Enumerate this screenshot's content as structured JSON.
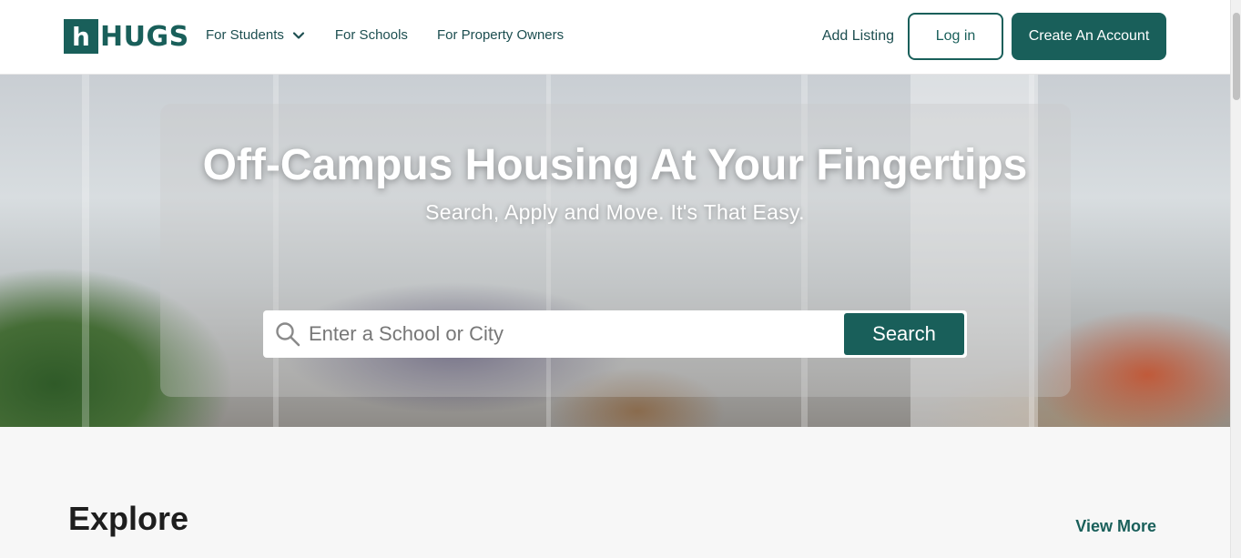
{
  "header": {
    "logo_text": "HUGS",
    "logo_mark": "h",
    "nav": [
      {
        "label": "For Students",
        "icon": "chevron-down-icon"
      },
      {
        "label": "For Schools"
      },
      {
        "label": "For Property Owners"
      }
    ],
    "add_listing": "Add Listing",
    "login": "Log in",
    "create_account": "Create An Account"
  },
  "hero": {
    "title": "Off-Campus Housing At Your Fingertips",
    "subtitle": "Search, Apply and Move. It's That Easy.",
    "search": {
      "placeholder": "Enter a School or City",
      "value": "",
      "button": "Search",
      "icon": "search-icon"
    }
  },
  "explore": {
    "title": "Explore",
    "view_more": "View More"
  },
  "colors": {
    "brand": "#195f5a",
    "nav_text": "#1c4e50"
  }
}
